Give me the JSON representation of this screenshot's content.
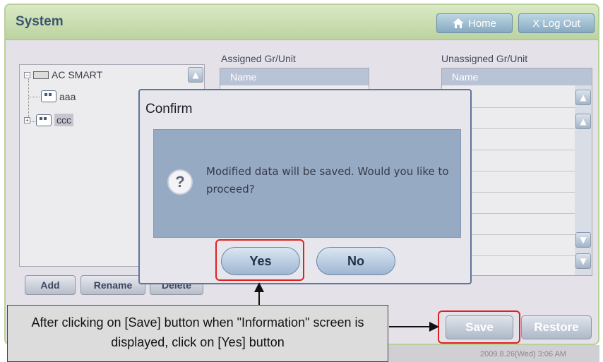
{
  "header": {
    "title": "System",
    "home_label": "Home",
    "logout_label": "X Log Out"
  },
  "tree": {
    "root_label": "AC SMART",
    "items": [
      {
        "label": "aaa",
        "selected": false
      },
      {
        "label": "ccc",
        "selected": true
      }
    ]
  },
  "tree_buttons": {
    "add": "Add",
    "rename": "Rename",
    "delete": "Delete"
  },
  "assigned": {
    "title": "Assigned Gr/Unit",
    "column": "Name"
  },
  "unassigned": {
    "title": "Unassigned Gr/Unit",
    "column": "Name"
  },
  "actions": {
    "save": "Save",
    "restore": "Restore"
  },
  "status": {
    "datetime": "2009.8.26(Wed)  3:06 AM"
  },
  "dialog": {
    "title": "Confirm",
    "message": "Modified data will be saved.  Would you like to proceed?",
    "icon": "question-icon",
    "yes": "Yes",
    "no": "No"
  },
  "annotation": {
    "text": "After clicking on [Save] button when \"Information\" screen is displayed, click on [Yes] button"
  },
  "colors": {
    "highlight": "#e02020",
    "title_bar": "#c9dcb1",
    "dialog_border": "#5f7599"
  }
}
